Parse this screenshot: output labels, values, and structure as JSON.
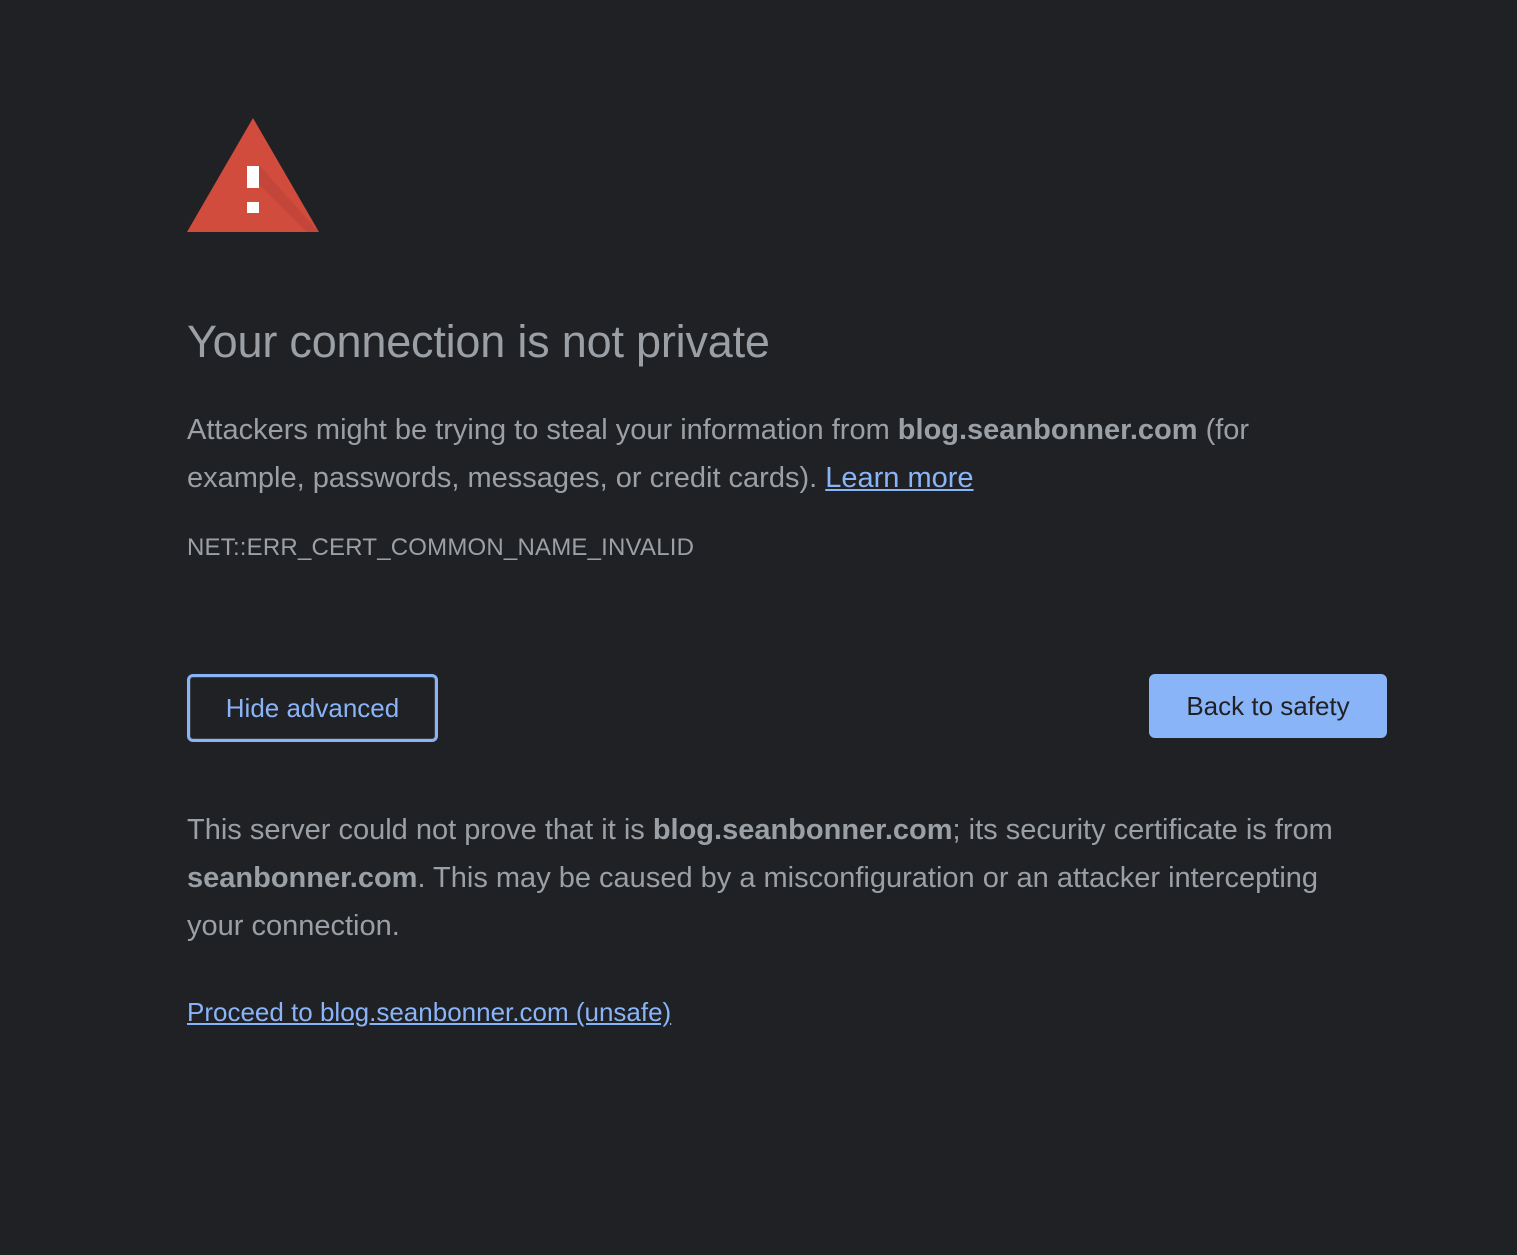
{
  "title": "Your connection is not private",
  "description": {
    "text_before": "Attackers might be trying to steal your information from ",
    "domain": "blog.seanbonner.com",
    "text_after": " (for example, passwords, messages, or credit cards). ",
    "learn_more_label": "Learn more"
  },
  "error_code": "NET::ERR_CERT_COMMON_NAME_INVALID",
  "buttons": {
    "hide_advanced_label": "Hide advanced",
    "back_to_safety_label": "Back to safety"
  },
  "details": {
    "text_1": "This server could not prove that it is ",
    "domain": "blog.seanbonner.com",
    "text_2": "; its security certificate is from ",
    "cert_domain": "seanbonner.com",
    "text_3": ". This may be caused by a misconfiguration or an attacker intercepting your connection."
  },
  "proceed_link_label": "Proceed to blog.seanbonner.com (unsafe)",
  "icon": "warning-triangle-icon",
  "colors": {
    "background": "#202124",
    "text": "#9aa0a6",
    "accent": "#8ab4f8",
    "warning_red": "#d24c3e"
  }
}
